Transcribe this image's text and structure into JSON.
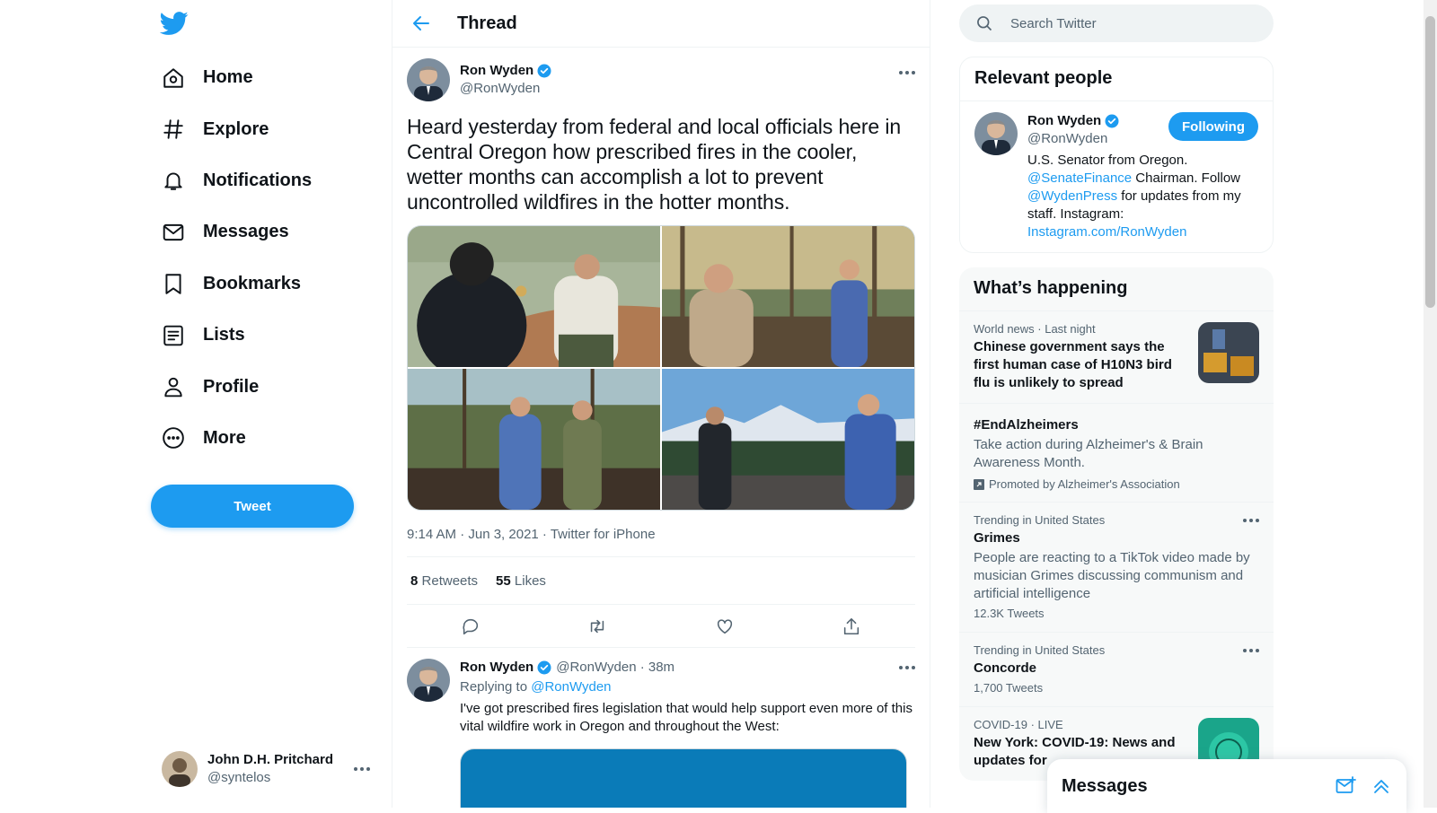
{
  "nav": {
    "items": [
      {
        "label": "Home",
        "icon": "home-icon"
      },
      {
        "label": "Explore",
        "icon": "hashtag-icon"
      },
      {
        "label": "Notifications",
        "icon": "bell-icon"
      },
      {
        "label": "Messages",
        "icon": "envelope-icon"
      },
      {
        "label": "Bookmarks",
        "icon": "bookmark-icon"
      },
      {
        "label": "Lists",
        "icon": "list-icon"
      },
      {
        "label": "Profile",
        "icon": "person-icon"
      },
      {
        "label": "More",
        "icon": "more-circle-icon"
      }
    ],
    "tweet_button": "Tweet"
  },
  "account": {
    "name": "John D.H. Pritchard",
    "handle": "@syntelos"
  },
  "thread": {
    "header": "Thread",
    "tweet": {
      "author": "Ron Wyden",
      "handle": "@RonWyden",
      "text": "Heard yesterday from federal and local officials here in Central Oregon how prescribed fires in the cooler, wetter months can accomplish a lot to prevent uncontrolled wildfires in the hotter months.",
      "time": "9:14 AM · Jun 3, 2021 · ",
      "source": "Twitter for iPhone",
      "retweets": "8",
      "retweets_label": "Retweets",
      "likes": "55",
      "likes_label": "Likes"
    },
    "reply": {
      "author": "Ron Wyden",
      "handle": "@RonWyden · 38m",
      "replying_prefix": "Replying to ",
      "replying_to": "@RonWyden",
      "text": "I've got prescribed fires legislation that would help support even more of this vital wildfire work in Oregon and throughout the West:"
    }
  },
  "search": {
    "placeholder": "Search Twitter"
  },
  "relevant": {
    "title": "Relevant people",
    "person": {
      "name": "Ron Wyden",
      "handle": "@RonWyden",
      "follow_label": "Following",
      "bio_1": "U.S. Senator from Oregon. ",
      "bio_link_1": "@SenateFinance",
      "bio_2": " Chairman. Follow ",
      "bio_link_2": "@WydenPress",
      "bio_3": " for updates from my staff. Instagram: ",
      "bio_link_3": "Instagram.com/RonWyden"
    }
  },
  "happening": {
    "title": "What’s happening",
    "trends": [
      {
        "meta": "World news · Last night",
        "title": "Chinese government says the first human case of H10N3 bird flu is unlikely to spread"
      },
      {
        "title": "#EndAlzheimers",
        "desc": "Take action during Alzheimer's & Brain Awareness Month.",
        "promoted": "Promoted by Alzheimer's Association"
      },
      {
        "meta": "Trending in United States",
        "title": "Grimes",
        "desc": "People are reacting to a TikTok video made by musician Grimes discussing communism and artificial intelligence",
        "count": "12.3K Tweets"
      },
      {
        "meta": "Trending in United States",
        "title": "Concorde",
        "count": "1,700 Tweets"
      },
      {
        "meta": "COVID-19 · LIVE",
        "title": "New York: COVID-19: News and updates for"
      }
    ]
  },
  "messages_dock": {
    "title": "Messages"
  },
  "colors": {
    "accent": "#1d9bf0",
    "text": "#0f1419",
    "secondary": "#536471"
  }
}
